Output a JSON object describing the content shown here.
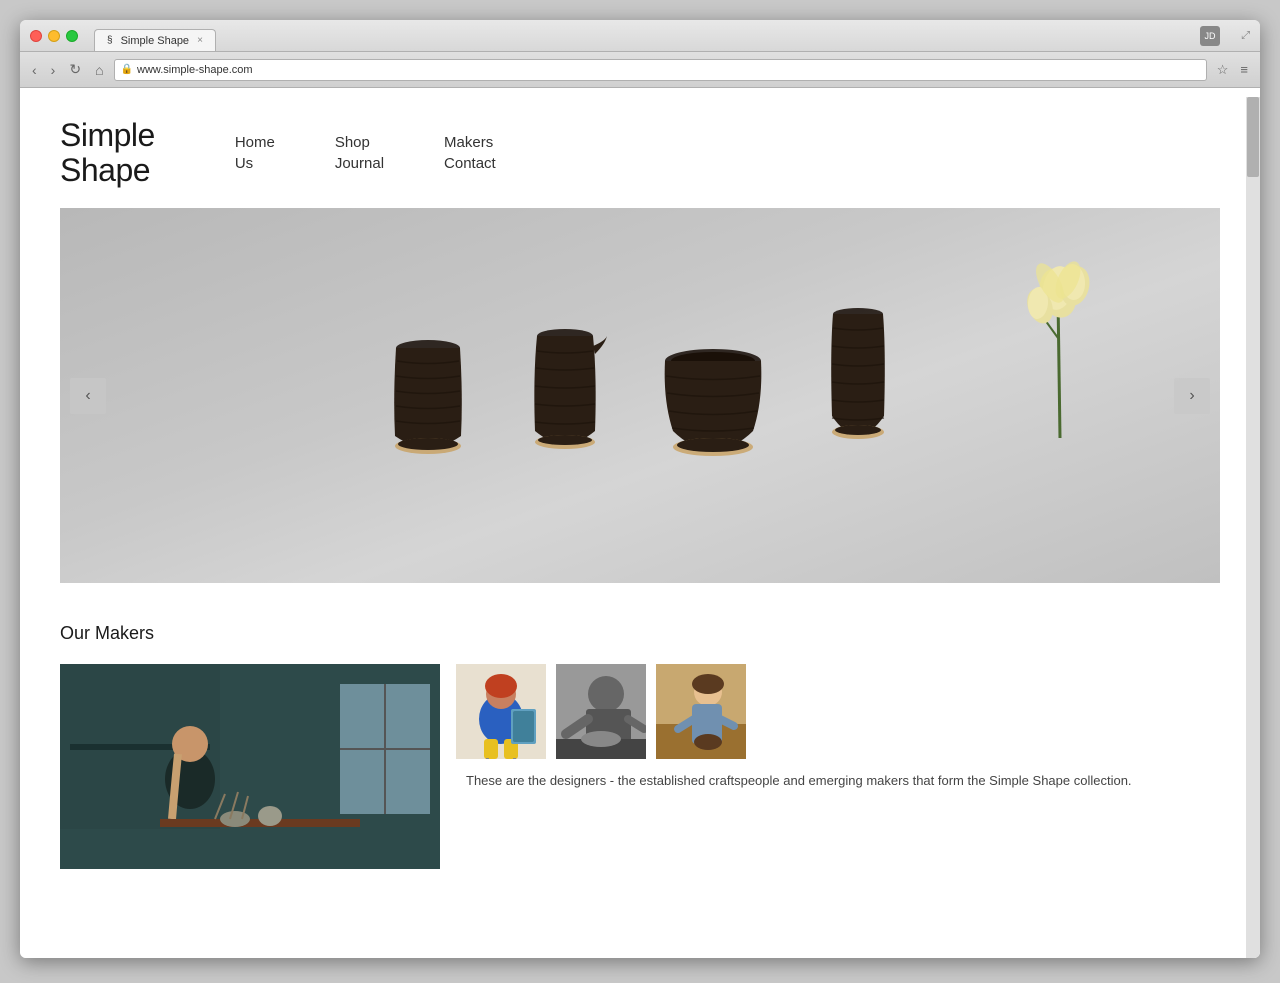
{
  "browser": {
    "tab_favicon": "§",
    "tab_title": "Simple Shape",
    "tab_close": "×",
    "url": "www.simple-shape.com",
    "user_initials": "JD",
    "nav_back": "‹",
    "nav_forward": "›",
    "nav_refresh": "↻",
    "nav_home": "⌂",
    "bookmark_icon": "☆",
    "menu_icon": "≡"
  },
  "site": {
    "logo_line1": "Simple",
    "logo_line2": "Shape"
  },
  "nav": {
    "col1": {
      "link1": "Home",
      "link2": "Us"
    },
    "col2": {
      "link1": "Shop",
      "link2": "Journal"
    },
    "col3": {
      "link1": "Makers",
      "link2": "Contact"
    }
  },
  "slider": {
    "arrow_left": "‹",
    "arrow_right": "›"
  },
  "makers": {
    "section_title": "Our Makers",
    "description": "These are the designers - the established craftspeople and emerging makers that form the Simple Shape collection."
  }
}
